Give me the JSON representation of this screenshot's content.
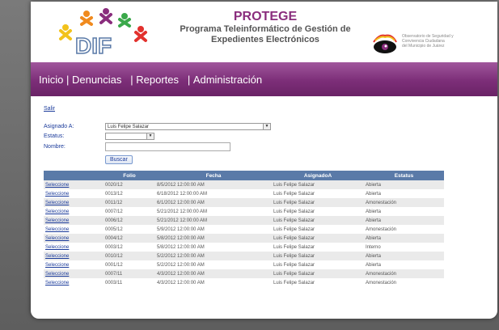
{
  "header": {
    "title": "PROTEGE",
    "subtitle_line1": "Programa Teleinformático de Gestión de",
    "subtitle_line2": "Expedientes Electrónicos",
    "partner_line1": "Observatorio de Seguridad y",
    "partner_line2": "Convivencia Ciudadana",
    "partner_line3": "del Municipio de Juárez"
  },
  "nav": {
    "items": [
      "Inicio",
      "Denuncias",
      "Reportes",
      "Administración"
    ]
  },
  "logout_label": "Salir",
  "form": {
    "assigned_label": "Asignado A:",
    "assigned_value": "Luis Felipe Salazar",
    "status_label": "Estatus:",
    "status_value": "",
    "name_label": "Nombre:",
    "name_value": "",
    "search_label": "Buscar"
  },
  "table": {
    "headers": [
      "",
      "Folio",
      "Fecha",
      "AsignadoA",
      "Estatus"
    ],
    "rows": [
      [
        "Seleccione",
        "0020/12",
        "8/5/2012 12:00:00 AM",
        "Luis Felipe Salazar",
        "Abierta"
      ],
      [
        "Seleccione",
        "0013/12",
        "6/18/2012 12:00:00 AM",
        "Luis Felipe Salazar",
        "Abierta"
      ],
      [
        "Seleccione",
        "0011/12",
        "6/1/2012 12:00:00 AM",
        "Luis Felipe Salazar",
        "Amonestación"
      ],
      [
        "Seleccione",
        "0007/12",
        "5/21/2012 12:00:00 AM",
        "Luis Felipe Salazar",
        "Abierta"
      ],
      [
        "Seleccione",
        "0006/12",
        "5/21/2012 12:00:00 AM",
        "Luis Felipe Salazar",
        "Abierta"
      ],
      [
        "Seleccione",
        "0005/12",
        "5/9/2012 12:00:00 AM",
        "Luis Felipe Salazar",
        "Amonestación"
      ],
      [
        "Seleccione",
        "0004/12",
        "5/8/2012 12:00:00 AM",
        "Luis Felipe Salazar",
        "Abierta"
      ],
      [
        "Seleccione",
        "0003/12",
        "5/8/2012 12:00:00 AM",
        "Luis Felipe Salazar",
        "Interno"
      ],
      [
        "Seleccione",
        "0010/12",
        "5/2/2012 12:00:00 AM",
        "Luis Felipe Salazar",
        "Abierta"
      ],
      [
        "Seleccione",
        "0001/12",
        "5/2/2012 12:00:00 AM",
        "Luis Felipe Salazar",
        "Abierta"
      ],
      [
        "Seleccione",
        "0007/11",
        "4/3/2012 12:00:00 AM",
        "Luis Felipe Salazar",
        "Amonestación"
      ],
      [
        "Seleccione",
        "0003/11",
        "4/3/2012 12:00:00 AM",
        "Luis Felipe Salazar",
        "Amonestación"
      ]
    ]
  },
  "colors": {
    "brand_purple": "#7c2e78",
    "table_header": "#5a7aa8",
    "link_blue": "#1a3a9a"
  },
  "icons": {
    "logo": "dif-logo",
    "partner_logo": "eye-logo",
    "dropdown": "chevron-down-icon"
  }
}
